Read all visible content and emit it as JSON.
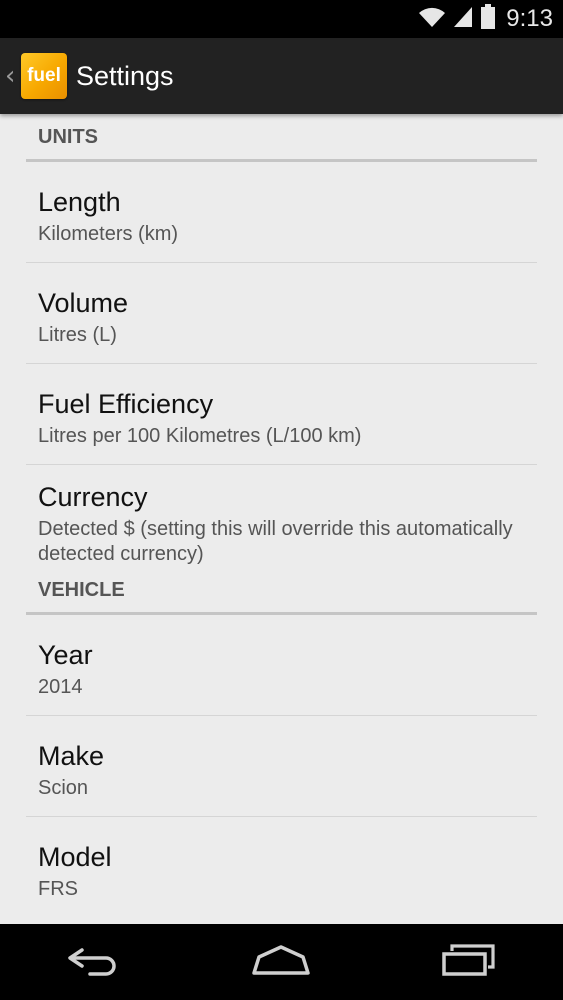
{
  "status_bar": {
    "time": "9:13",
    "icons": [
      "wifi-icon",
      "signal-icon",
      "battery-icon"
    ]
  },
  "action_bar": {
    "app_logo_text": "fuel",
    "title": "Settings",
    "accent_color": "#f7a800"
  },
  "sections": [
    {
      "header": "UNITS",
      "items": [
        {
          "title": "Length",
          "summary": "Kilometers (km)"
        },
        {
          "title": "Volume",
          "summary": "Litres (L)"
        },
        {
          "title": "Fuel Efficiency",
          "summary": "Litres per 100 Kilometres (L/100 km)"
        },
        {
          "title": "Currency",
          "summary": "Detected $ (setting this will override this automatically detected currency)"
        }
      ]
    },
    {
      "header": "VEHICLE",
      "items": [
        {
          "title": "Year",
          "summary": "2014"
        },
        {
          "title": "Make",
          "summary": "Scion"
        },
        {
          "title": "Model",
          "summary": "FRS"
        }
      ]
    }
  ],
  "nav_bar": {
    "buttons": [
      "back-icon",
      "home-icon",
      "recents-icon"
    ]
  }
}
